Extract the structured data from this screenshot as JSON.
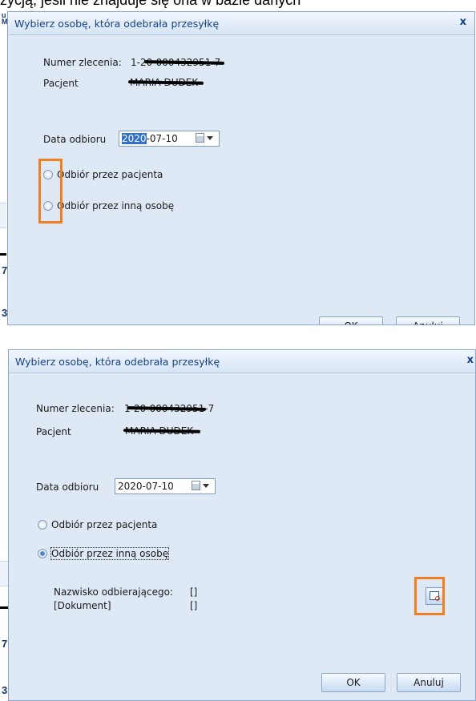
{
  "background": {
    "doc_text": "życją, jeśli nie znajduje się ona w bazie danych",
    "left_fragments": [
      "u",
      "M",
      "7",
      "3",
      "7",
      "3"
    ]
  },
  "dialog_1": {
    "title": "Wybierz osobę, która odebrała przesyłkę",
    "close": "x",
    "order_label": "Numer zlecenia:",
    "order_value": "1-20-000432951-7",
    "patient_label": "Pacjent",
    "patient_value": "MARIA DUDEK",
    "date_label": "Data odbioru",
    "date_year": "2020",
    "date_rest": "-07-10",
    "radio_patient": "Odbiór przez pacjenta",
    "radio_other": "Odbiór przez inną osobę",
    "ok": "OK",
    "cancel": "Anuluj"
  },
  "dialog_2": {
    "title": "Wybierz osobę, która odebrała przesyłkę",
    "close": "x",
    "order_label": "Numer zlecenia:",
    "order_value": "1-20-000432951-7",
    "patient_label": "Pacjent",
    "patient_value": "MARIA DUDEK",
    "date_label": "Data odbioru",
    "date_value": "2020-07-10",
    "radio_patient": "Odbiór przez pacjenta",
    "radio_other": "Odbiór przez inną osobę",
    "surname_label": "Nazwisko odbierającego:",
    "surname_value": "[]",
    "document_label": "[Dokument]",
    "document_value": "[]",
    "ok": "OK",
    "cancel": "Anuluj"
  },
  "state": {
    "dialog_1_selected": "none",
    "dialog_2_selected": "Odbiór przez inną osobę"
  },
  "colors": {
    "highlight": "#f07f21",
    "title_text": "#15428b",
    "dialog_bg": "#dfe9f5"
  },
  "icons": [
    "calendar-icon",
    "dropdown-arrow-icon",
    "radio-icon",
    "search-lookup-icon",
    "close-icon"
  ]
}
